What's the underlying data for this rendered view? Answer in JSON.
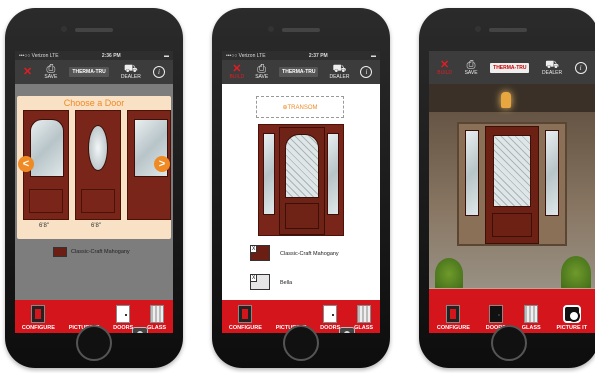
{
  "phone1": {
    "status": {
      "carrier": "•••○○ Verizon  LTE",
      "time": "2:36 PM",
      "battery": "▬"
    },
    "toolbar": {
      "save": "SAVE",
      "logo": "THERMA-TRU",
      "dealer": "DEALER"
    },
    "chooser": {
      "title": "Choose a Door",
      "labels": [
        "6'8\"",
        "6'8\""
      ],
      "prev": "<",
      "next": ">"
    },
    "finish_label": "Classic-Craft Mahogany",
    "bottom": {
      "items": [
        "CONFIGURE",
        "PICTURE IT",
        "DOORS",
        "GLASS"
      ]
    }
  },
  "phone2": {
    "status": {
      "carrier": "•••○○ Verizon  LTE",
      "time": "2:37 PM",
      "battery": "▬"
    },
    "toolbar": {
      "build": "BUILD",
      "save": "SAVE",
      "logo": "THERMA-TRU",
      "dealer": "DEALER"
    },
    "transom": "⊕TRANSOM",
    "options": [
      {
        "x": "X",
        "label": "Classic-Craft Mahogany"
      },
      {
        "x": "X",
        "label": "Bella"
      }
    ],
    "bottom": {
      "items": [
        "CONFIGURE",
        "PICTURE IT",
        "DOORS",
        "GLASS"
      ]
    }
  },
  "phone3": {
    "toolbar": {
      "build": "BUILD",
      "save": "SAVE",
      "logo": "THERMA-TRU",
      "dealer": "DEALER"
    },
    "bottom": {
      "items": [
        "CONFIGURE",
        "DOORS",
        "GLASS",
        "PICTURE IT"
      ]
    }
  },
  "colors": {
    "accent_red": "#d4151c",
    "orange": "#f08a24",
    "mahogany": "#7a2519"
  }
}
